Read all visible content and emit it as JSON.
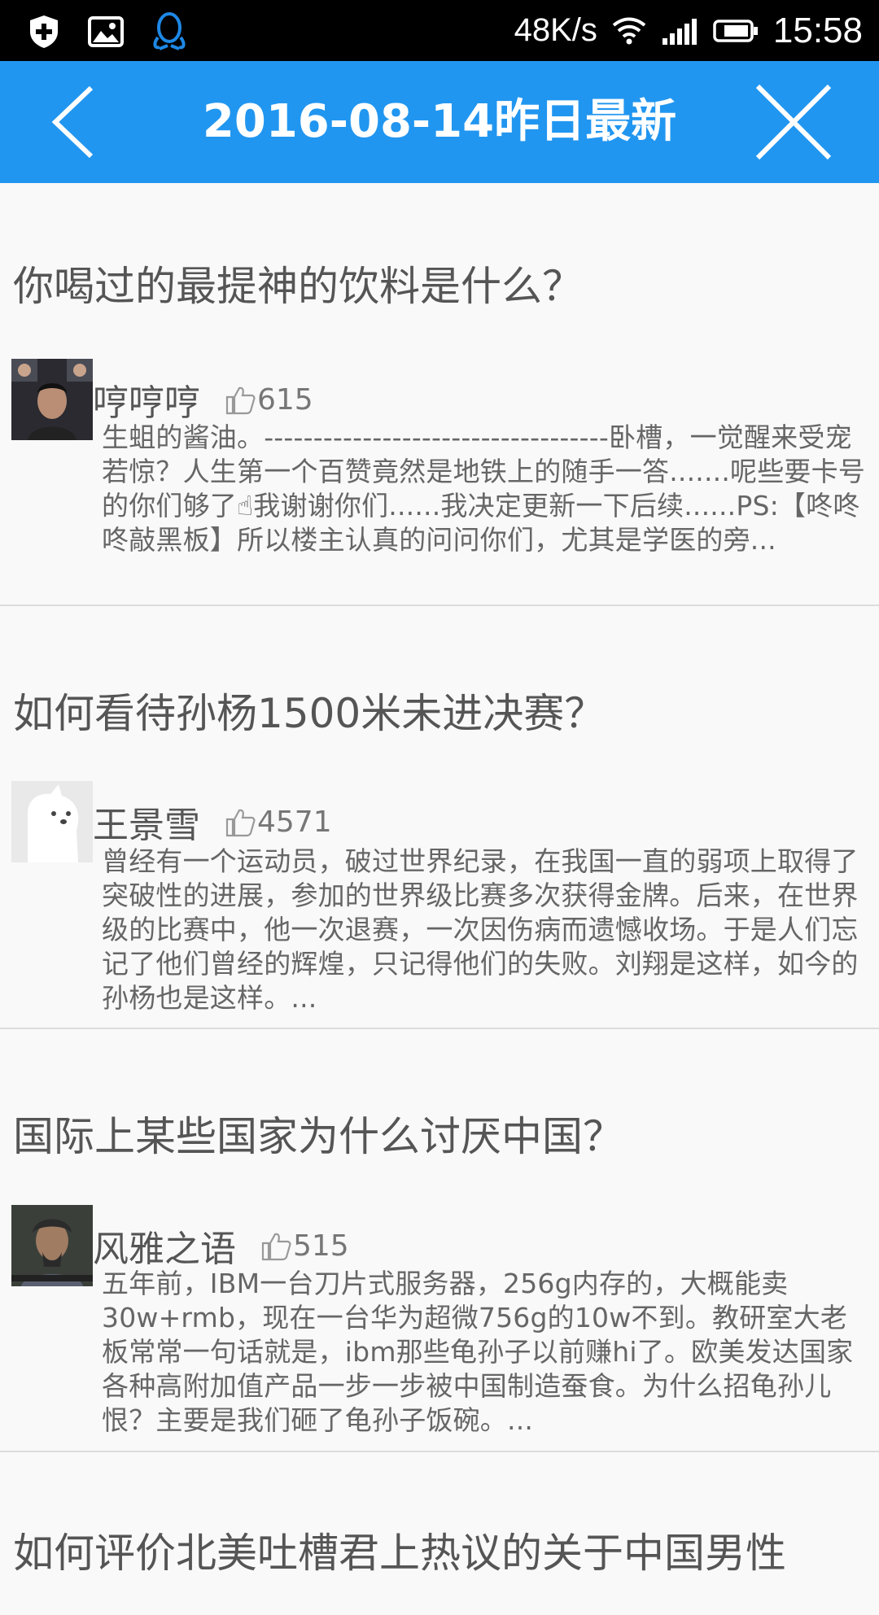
{
  "status_bar": {
    "speed": "48K/s",
    "time": "15:58",
    "icons": [
      "shield-plus-icon",
      "image-icon",
      "qq-penguin-icon",
      "wifi-icon",
      "signal-icon",
      "battery-icon"
    ]
  },
  "header": {
    "title": "2016-08-14昨日最新",
    "back_icon": "chevron-left-icon",
    "close_icon": "close-icon",
    "color": "#2196f0"
  },
  "feed": {
    "items": [
      {
        "question": "你喝过的最提神的饮料是什么？",
        "author": "哼哼哼",
        "likes": "615",
        "excerpt": "生蛆的酱油。-----------------------------------卧槽，一觉醒来受宠若惊？人生第一个百赞竟然是地铁上的随手一答.......呢些要卡号的你们够了☝我谢谢你们......我决定更新一下后续......PS:【咚咚咚敲黑板】所以楼主认真的问问你们，尤其是学医的旁..."
      },
      {
        "question": "如何看待孙杨1500米未进决赛？",
        "author": "王景雪",
        "likes": "4571",
        "excerpt": "曾经有一个运动员，破过世界纪录，在我国一直的弱项上取得了突破性的进展，参加的世界级比赛多次获得金牌。后来，在世界级的比赛中，他一次退赛，一次因伤病而遗憾收场。于是人们忘记了他们曾经的辉煌，只记得他们的失败。刘翔是这样，如今的孙杨也是这样。..."
      },
      {
        "question": "国际上某些国家为什么讨厌中国？",
        "author": "风雅之语",
        "likes": "515",
        "excerpt": "五年前，IBM一台刀片式服务器，256g内存的，大概能卖30w+rmb，现在一台华为超微756g的10w不到。教研室大老板常常一句话就是，ibm那些龟孙子以前赚hi了。欧美发达国家各种高附加值产品一步一步被中国制造蚕食。为什么招龟孙儿恨？主要是我们砸了龟孙子饭碗。..."
      },
      {
        "question": "如何评价北美吐槽君上热议的关于中国男性"
      }
    ]
  }
}
